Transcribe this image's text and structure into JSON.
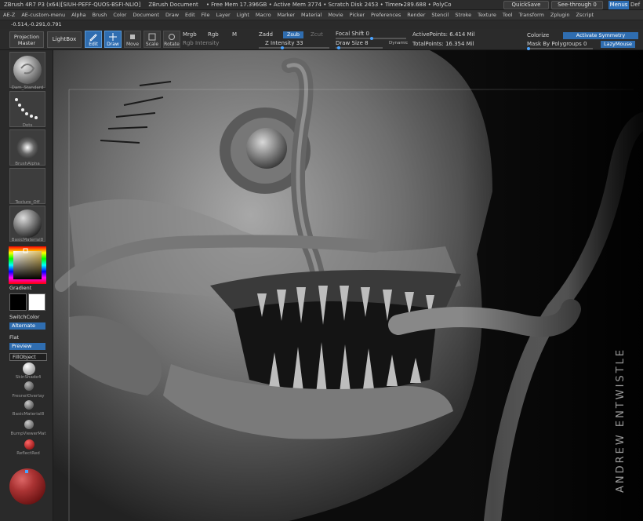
{
  "titlebar": {
    "items": [
      "ZBrush 4R7 P3 (x64)[SIUH-PEFF-QUOS-BSFI-NLIO]",
      "ZBrush Document",
      "• Free Mem 17.396GB • Active Mem 3774 • Scratch Disk 2453 • Timer▸289.688 • PolyCo"
    ],
    "quicksave": "QuickSave",
    "seethrough": "See-through 0",
    "menus": "Menus",
    "default": "Def"
  },
  "menubar": [
    "AE-Z",
    "AE-custom-menu",
    "Alpha",
    "Brush",
    "Color",
    "Document",
    "Draw",
    "Edit",
    "File",
    "Layer",
    "Light",
    "Macro",
    "Marker",
    "Material",
    "Movie",
    "Picker",
    "Preferences",
    "Render",
    "Stencil",
    "Stroke",
    "Texture",
    "Tool",
    "Transform",
    "Zplugin",
    "Zscript"
  ],
  "coords": "-0.514,-0.291,0.791",
  "toolbar": {
    "projection_master": "Projection\nMaster",
    "lightbox": "LightBox",
    "edit": "Edit",
    "draw": "Draw",
    "move": "Move",
    "scale": "Scale",
    "rotate": "Rotate",
    "mrgb": "Mrgb",
    "rgb": "Rgb",
    "m": "M",
    "rgb_intensity": "Rgb Intensity",
    "zadd": "Zadd",
    "zsub": "Zsub",
    "zcut": "Zcut",
    "z_intensity": "Z Intensity 33",
    "focal_shift": "Focal Shift 0",
    "draw_size": "Draw Size 8",
    "dynamic": "Dynamic",
    "active_points": "ActivePoints: 6.414 Mil",
    "total_points": "TotalPoints: 16.354 Mil",
    "colorize": "Colorize",
    "activate_symmetry": "Activate Symmetry",
    "mask_by_polygroups": "Mask By Polygroups 0",
    "lazymouse": "LazyMouse"
  },
  "leftpanel": {
    "brush": "Dam_Standard",
    "stroke": "Dots",
    "alpha": "BrushAlpha",
    "texture": "Texture_Off",
    "material": "BasicMaterial8",
    "gradient": "Gradient",
    "switchcolor": "SwitchColor",
    "alternate": "Alternate",
    "flat": "Flat",
    "preview": "Preview",
    "fillobject": "FillObject",
    "mat1": "SkinShade4",
    "mat2": "FresnelOverlay",
    "mat3": "BasicMaterial8",
    "mat4": "BumpViewerMat",
    "mat5": "ReflectRed"
  },
  "watermark": "ANDREW ENTWISTLE",
  "colors": {
    "accent": "#2f6db0",
    "main_color": "#e0c060"
  }
}
